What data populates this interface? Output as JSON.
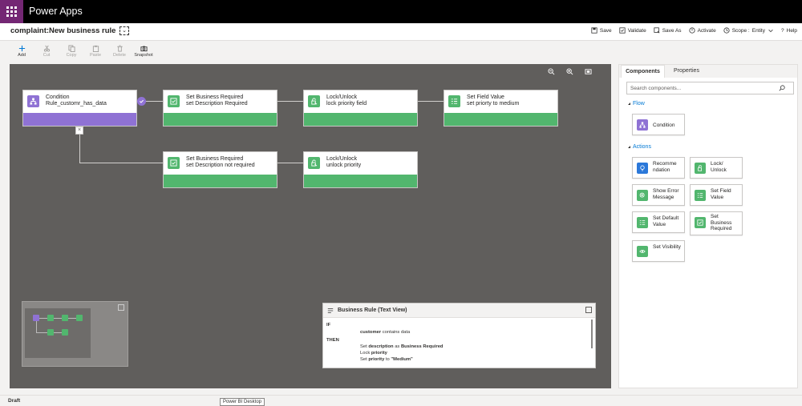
{
  "app": {
    "name": "Power Apps"
  },
  "header": {
    "rule_title": "complaint:New business rule",
    "commands": [
      {
        "label": "Save",
        "icon": "save-icon"
      },
      {
        "label": "Validate",
        "icon": "validate-icon"
      },
      {
        "label": "Save As",
        "icon": "save-as-icon"
      },
      {
        "label": "Activate",
        "icon": "activate-icon"
      },
      {
        "label": "Scope :",
        "icon": "clock-icon"
      },
      {
        "label": "Entity",
        "icon": "chevron-down-icon"
      },
      {
        "label": "Help",
        "icon": "help-icon"
      }
    ]
  },
  "toolbar": {
    "add": "Add",
    "cut": "Cut",
    "copy": "Copy",
    "paste": "Paste",
    "delete": "Delete",
    "snapshot": "Snapshot"
  },
  "canvas": {
    "nodes": [
      {
        "id": "condition",
        "title": "Condition",
        "subtitle": "Rule_customr_has_data",
        "kind": "condition",
        "icon": "condition-icon"
      },
      {
        "id": "set-business-required-1",
        "title": "Set Business Required",
        "subtitle": "set Description Required",
        "kind": "action",
        "icon": "business-required-icon"
      },
      {
        "id": "lock-unlock-1",
        "title": "Lock/Unlock",
        "subtitle": "lock priority field",
        "kind": "action",
        "icon": "lock-icon"
      },
      {
        "id": "set-field-value",
        "title": "Set Field Value",
        "subtitle": "set priorty to medium",
        "kind": "action",
        "icon": "field-value-icon"
      },
      {
        "id": "set-business-required-2",
        "title": "Set Business Required",
        "subtitle": "set Description not required",
        "kind": "action",
        "icon": "business-required-icon"
      },
      {
        "id": "lock-unlock-2",
        "title": "Lock/Unlock",
        "subtitle": "unlock priority",
        "kind": "action",
        "icon": "lock-icon"
      }
    ],
    "colors": {
      "condition": "#8f72d4",
      "action": "#52b66e",
      "canvas_bg": "#605e5c"
    }
  },
  "text_view": {
    "title": "Business Rule (Text View)",
    "if": "IF",
    "condition_field": "customer",
    "condition_text": "contains data",
    "then": "THEN",
    "line1_prefix": "Set",
    "line1_field": "description",
    "line1_mid": "as",
    "line1_value": "Business Required",
    "line2_prefix": "Lock",
    "line2_field": "priority",
    "line3_prefix": "Set",
    "line3_field": "priority",
    "line3_mid": "to",
    "line3_value": "\"Medium\""
  },
  "right_panel": {
    "tabs": [
      {
        "label": "Components",
        "active": true
      },
      {
        "label": "Properties",
        "active": false
      }
    ],
    "search_placeholder": "Search components...",
    "flow_label": "Flow",
    "flow_items": [
      {
        "label": "Condition",
        "icon": "condition-icon"
      }
    ],
    "actions_label": "Actions",
    "action_items": [
      {
        "label": "Recomme ndation",
        "icon": "lightbulb-icon",
        "color": "#2b78d9"
      },
      {
        "label": "Lock/ Unlock",
        "icon": "lock-icon",
        "color": "#52b66e"
      },
      {
        "label": "Show Error Message",
        "icon": "error-icon",
        "color": "#52b66e"
      },
      {
        "label": "Set Field Value",
        "icon": "field-value-icon",
        "color": "#52b66e"
      },
      {
        "label": "Set Default Value",
        "icon": "default-value-icon",
        "color": "#52b66e"
      },
      {
        "label": "Set Business Required",
        "icon": "business-required-icon",
        "color": "#52b66e"
      },
      {
        "label": "Set Visibility",
        "icon": "eye-icon",
        "color": "#52b66e"
      }
    ]
  },
  "status": {
    "label": "Draft",
    "tooltip": "Power BI Desktop"
  }
}
